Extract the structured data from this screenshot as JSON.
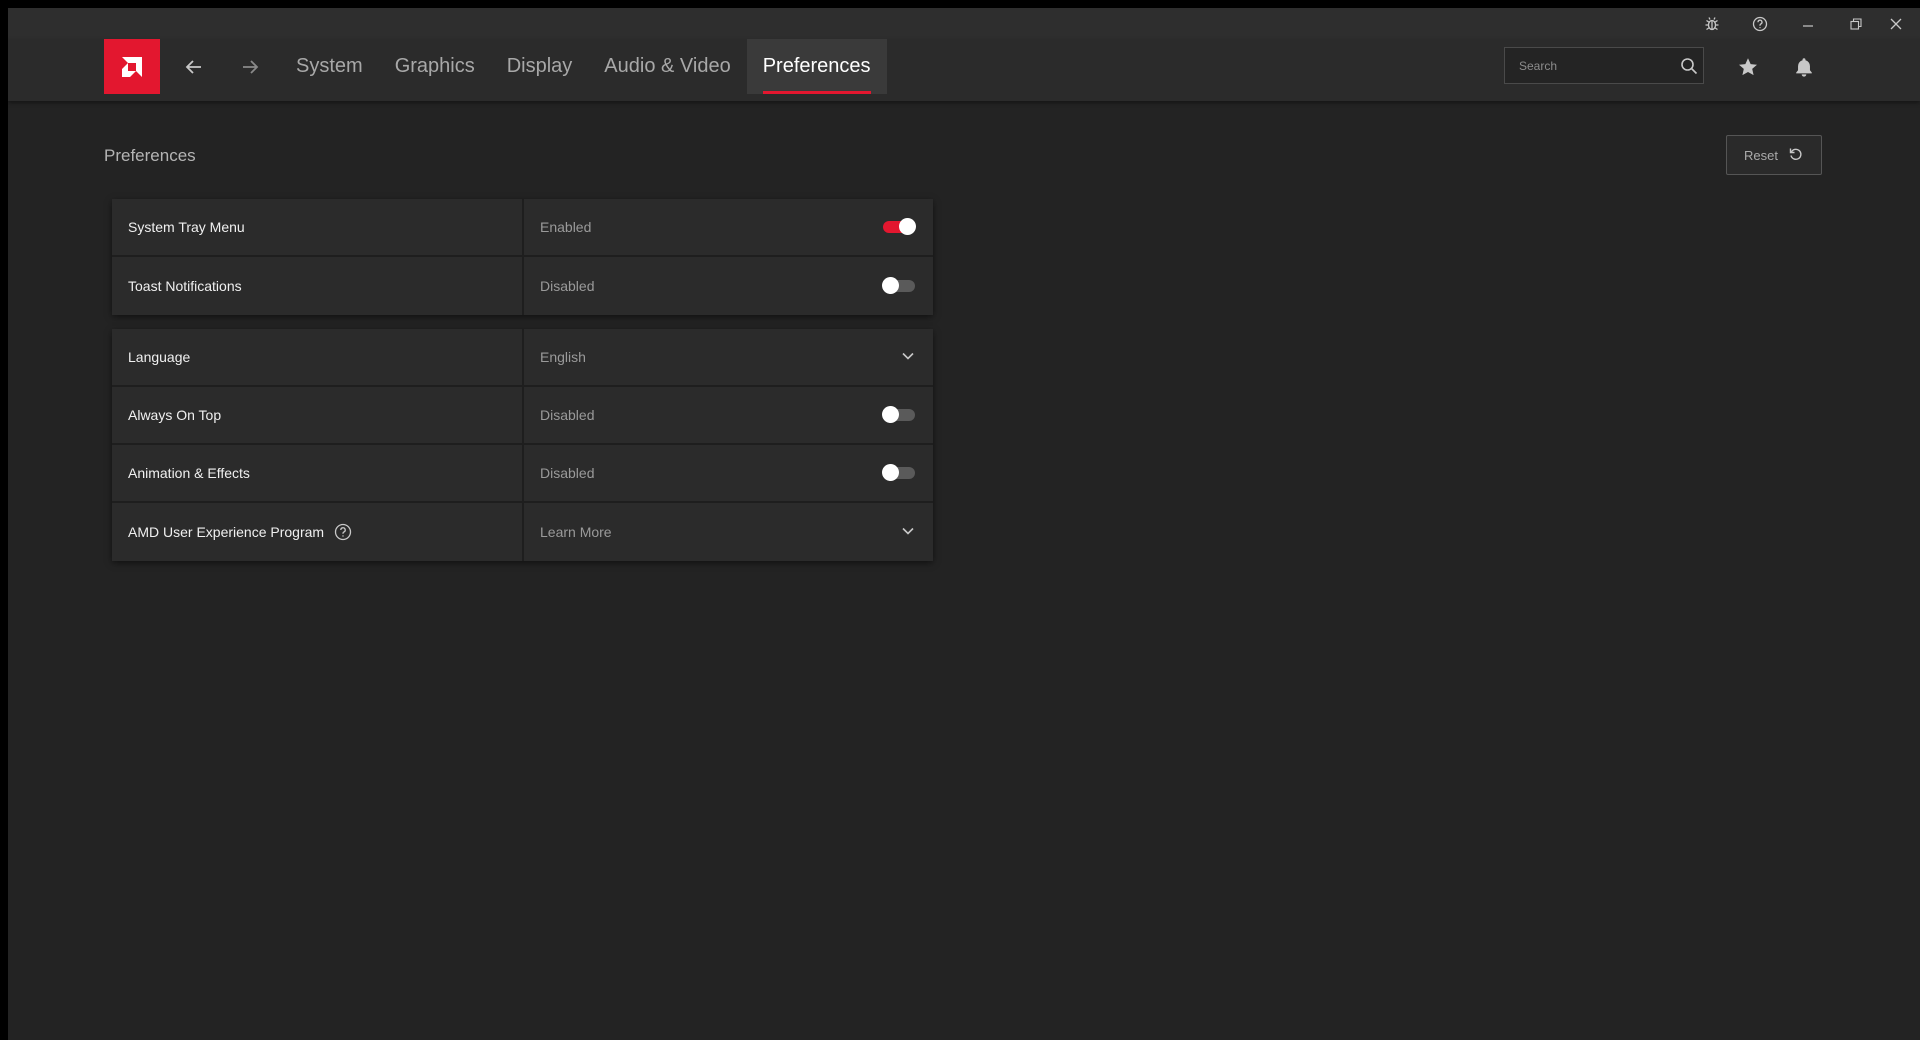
{
  "window": {
    "title_buttons": [
      "bug-report-icon",
      "help-icon",
      "minimize-icon",
      "restore-icon",
      "close-icon"
    ]
  },
  "nav": {
    "tabs": [
      {
        "label": "System"
      },
      {
        "label": "Graphics"
      },
      {
        "label": "Display"
      },
      {
        "label": "Audio & Video"
      },
      {
        "label": "Preferences",
        "active": true
      }
    ],
    "search_placeholder": "Search"
  },
  "page": {
    "title": "Preferences",
    "reset_label": "Reset"
  },
  "groups": [
    {
      "rows": [
        {
          "label": "System Tray Menu",
          "value": "Enabled",
          "control": "toggle",
          "on": true
        },
        {
          "label": "Toast Notifications",
          "value": "Disabled",
          "control": "toggle",
          "on": false
        }
      ]
    },
    {
      "rows": [
        {
          "label": "Language",
          "value": "English",
          "control": "dropdown"
        },
        {
          "label": "Always On Top",
          "value": "Disabled",
          "control": "toggle",
          "on": false
        },
        {
          "label": "Animation & Effects",
          "value": "Disabled",
          "control": "toggle",
          "on": false
        },
        {
          "label": "AMD User Experience Program",
          "value": "Learn More",
          "control": "dropdown",
          "help": true
        }
      ]
    }
  ],
  "colors": {
    "accent": "#e3172f",
    "background": "#232323",
    "row": "#2b2b2b"
  }
}
